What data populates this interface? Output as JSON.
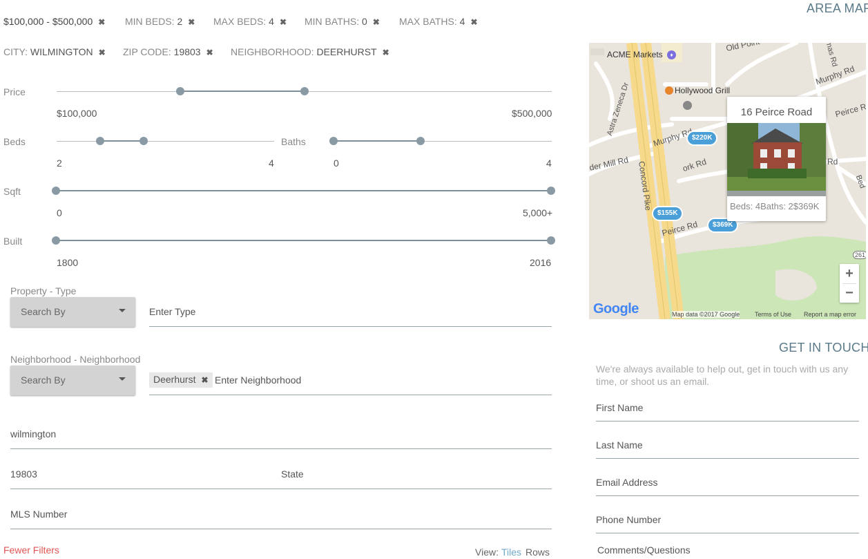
{
  "filters": {
    "row1": [
      {
        "label": "",
        "value": "$100,000 - $500,000"
      },
      {
        "label": "MIN BEDS: ",
        "value": "2"
      },
      {
        "label": "MAX BEDS: ",
        "value": "4"
      },
      {
        "label": "MIN BATHS: ",
        "value": "0"
      },
      {
        "label": "MAX BATHS: ",
        "value": "4"
      }
    ],
    "row2": [
      {
        "label": "CITY: ",
        "value": "WILMINGTON"
      },
      {
        "label": "ZIP CODE: ",
        "value": "19803"
      },
      {
        "label": "NEIGHBORHOOD: ",
        "value": "DEERHURST"
      }
    ],
    "remove_glyph": "✖"
  },
  "sliders": {
    "price": {
      "label": "Price",
      "min_label": "$100,000",
      "max_label": "$500,000",
      "low_pct": 25,
      "high_pct": 50
    },
    "beds": {
      "label": "Beds",
      "min_label": "2",
      "max_label": "4",
      "low_pct": 20,
      "high_pct": 40
    },
    "baths": {
      "label": "Baths",
      "min_label": "0",
      "max_label": "4",
      "low_pct": 0,
      "high_pct": 40
    },
    "sqft": {
      "label": "Sqft",
      "min_label": "0",
      "max_label": "5,000+",
      "low_pct": 0,
      "high_pct": 100
    },
    "built": {
      "label": "Built",
      "min_label": "1800",
      "max_label": "2016",
      "low_pct": 0,
      "high_pct": 100
    }
  },
  "form": {
    "property_type_label": "Property - Type",
    "neighborhood_label": "Neighborhood - Neighborhood",
    "search_by": "Search By",
    "type_placeholder": "Enter Type",
    "neighborhood_tag": "Deerhurst",
    "neighborhood_placeholder": "Enter Neighborhood",
    "city_value": "wilmington",
    "zip_value": "19803",
    "state_placeholder": "State",
    "mls_placeholder": "MLS Number",
    "fewer_filters": "Fewer Filters",
    "view_label": "View:",
    "view_tiles": "Tiles",
    "view_rows": "Rows"
  },
  "map": {
    "title": "AREA MAP",
    "labels": [
      "ACME Markets",
      "Hollywood Grill",
      "Old Point",
      "Murphy Rd",
      "Peirce Rd",
      "Astra Zeneca Dr",
      "Concord Pike",
      "der Mill Rd",
      "Murphy Rd",
      "ork Rd",
      "Peirce Rd",
      "Rd",
      "mas Rd",
      "Bed",
      "261"
    ],
    "pins": [
      "$220K",
      "$155K",
      "$369K"
    ],
    "card": {
      "title": "16 Peirce Road",
      "meta": "Beds: 4Baths: 2$369K"
    },
    "zoom_in": "+",
    "zoom_out": "−",
    "google": "Google",
    "footer": [
      "Map data ©2017 Google",
      "Terms of Use",
      "Report a map error"
    ]
  },
  "contact": {
    "title": "GET IN TOUCH",
    "description": "We're always available to help out, get in touch with us any time, or shoot us an email.",
    "fields": [
      "First Name",
      "Last Name",
      "Email Address",
      "Phone Number",
      "Comments/Questions"
    ]
  },
  "colors": {
    "accent": "#6fa8c9",
    "danger": "#e15454",
    "pin": "#4a9fd8",
    "heading": "#5a7a8a"
  }
}
